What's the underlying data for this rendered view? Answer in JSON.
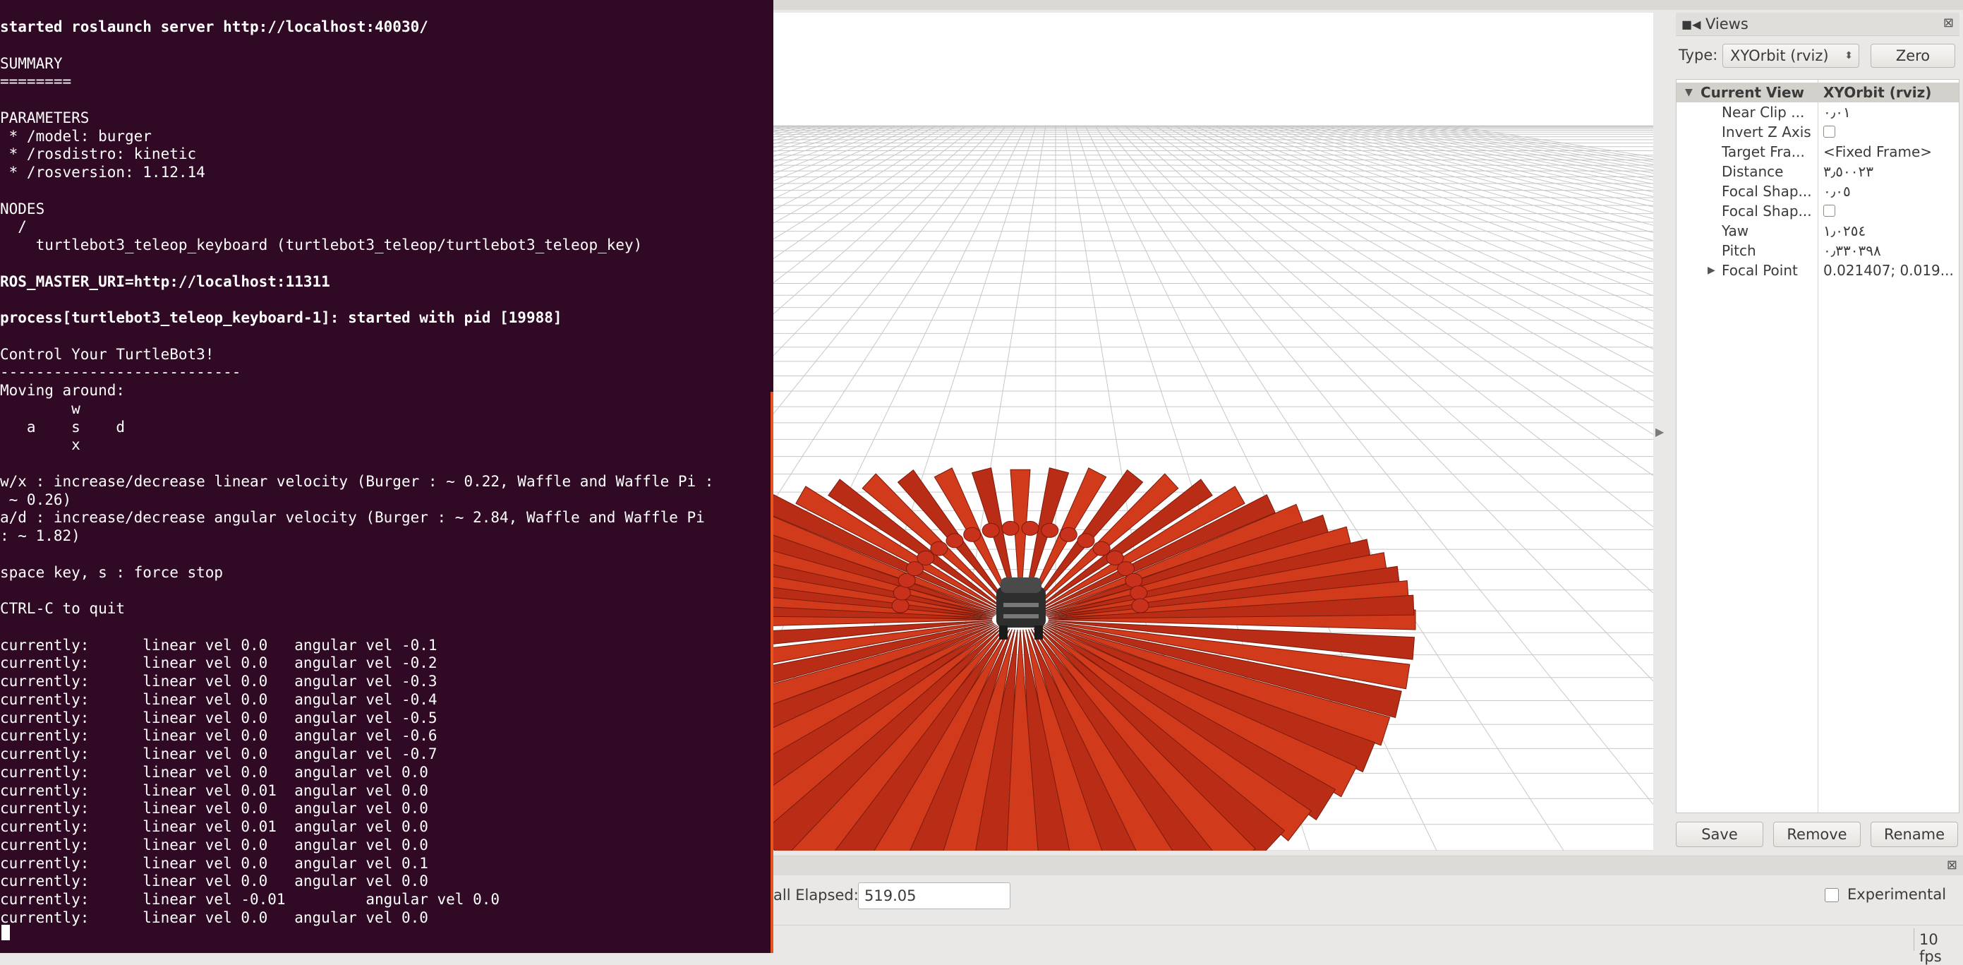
{
  "terminal": {
    "lines": [
      {
        "text": "started roslaunch server http://localhost:40030/",
        "bold": true
      },
      {
        "text": "",
        "bold": false
      },
      {
        "text": "SUMMARY",
        "bold": false
      },
      {
        "text": "========",
        "bold": false
      },
      {
        "text": "",
        "bold": false
      },
      {
        "text": "PARAMETERS",
        "bold": false
      },
      {
        "text": " * /model: burger",
        "bold": false
      },
      {
        "text": " * /rosdistro: kinetic",
        "bold": false
      },
      {
        "text": " * /rosversion: 1.12.14",
        "bold": false
      },
      {
        "text": "",
        "bold": false
      },
      {
        "text": "NODES",
        "bold": false
      },
      {
        "text": "  /",
        "bold": false
      },
      {
        "text": "    turtlebot3_teleop_keyboard (turtlebot3_teleop/turtlebot3_teleop_key)",
        "bold": false
      },
      {
        "text": "",
        "bold": false
      },
      {
        "text": "ROS_MASTER_URI=http://localhost:11311",
        "bold": true
      },
      {
        "text": "",
        "bold": false
      },
      {
        "text": "process[turtlebot3_teleop_keyboard-1]: started with pid [19988]",
        "bold": true
      },
      {
        "text": "",
        "bold": false
      },
      {
        "text": "Control Your TurtleBot3!",
        "bold": false
      },
      {
        "text": "---------------------------",
        "bold": false
      },
      {
        "text": "Moving around:",
        "bold": false
      },
      {
        "text": "        w",
        "bold": false
      },
      {
        "text": "   a    s    d",
        "bold": false
      },
      {
        "text": "        x",
        "bold": false
      },
      {
        "text": "",
        "bold": false
      },
      {
        "text": "w/x : increase/decrease linear velocity (Burger : ~ 0.22, Waffle and Waffle Pi :",
        "bold": false
      },
      {
        "text": " ~ 0.26)",
        "bold": false
      },
      {
        "text": "a/d : increase/decrease angular velocity (Burger : ~ 2.84, Waffle and Waffle Pi",
        "bold": false
      },
      {
        "text": ": ~ 1.82)",
        "bold": false
      },
      {
        "text": "",
        "bold": false
      },
      {
        "text": "space key, s : force stop",
        "bold": false
      },
      {
        "text": "",
        "bold": false
      },
      {
        "text": "CTRL-C to quit",
        "bold": false
      },
      {
        "text": "",
        "bold": false
      },
      {
        "text": "currently:\tlinear vel 0.0\t angular vel -0.1",
        "bold": false
      },
      {
        "text": "currently:\tlinear vel 0.0\t angular vel -0.2",
        "bold": false
      },
      {
        "text": "currently:\tlinear vel 0.0\t angular vel -0.3",
        "bold": false
      },
      {
        "text": "currently:\tlinear vel 0.0\t angular vel -0.4",
        "bold": false
      },
      {
        "text": "currently:\tlinear vel 0.0\t angular vel -0.5",
        "bold": false
      },
      {
        "text": "currently:\tlinear vel 0.0\t angular vel -0.6",
        "bold": false
      },
      {
        "text": "currently:\tlinear vel 0.0\t angular vel -0.7",
        "bold": false
      },
      {
        "text": "currently:\tlinear vel 0.0\t angular vel 0.0",
        "bold": false
      },
      {
        "text": "currently:\tlinear vel 0.01\t angular vel 0.0",
        "bold": false
      },
      {
        "text": "currently:\tlinear vel 0.0\t angular vel 0.0",
        "bold": false
      },
      {
        "text": "currently:\tlinear vel 0.01\t angular vel 0.0",
        "bold": false
      },
      {
        "text": "currently:\tlinear vel 0.0\t angular vel 0.0",
        "bold": false
      },
      {
        "text": "currently:\tlinear vel 0.0\t angular vel 0.1",
        "bold": false
      },
      {
        "text": "currently:\tlinear vel 0.0\t angular vel 0.0",
        "bold": false
      },
      {
        "text": "currently:\tlinear vel -0.01\t angular vel 0.0",
        "bold": false
      },
      {
        "text": "currently:\tlinear vel 0.0\t angular vel 0.0",
        "bold": false
      }
    ]
  },
  "views": {
    "title": "Views",
    "type_label": "Type:",
    "type_value": "XYOrbit (rviz)",
    "zero_label": "Zero",
    "header": {
      "name": "Current View",
      "value": "XYOrbit (rviz)"
    },
    "properties": [
      {
        "name": "Near Clip ...",
        "value": "٠٫٠١",
        "kind": "text"
      },
      {
        "name": "Invert Z Axis",
        "value": "",
        "kind": "check"
      },
      {
        "name": "Target Fra...",
        "value": "<Fixed Frame>",
        "kind": "text"
      },
      {
        "name": "Distance",
        "value": "٣٫٥٠٠٢٣",
        "kind": "text"
      },
      {
        "name": "Focal Shap...",
        "value": "٠٫٠٥",
        "kind": "text"
      },
      {
        "name": "Focal Shap...",
        "value": "",
        "kind": "check"
      },
      {
        "name": "Yaw",
        "value": "١٫٠٢٥٤",
        "kind": "text"
      },
      {
        "name": "Pitch",
        "value": "٠٫٣٣٠٣٩٨",
        "kind": "text"
      },
      {
        "name": "Focal Point",
        "value": "0.021407; 0.019...",
        "kind": "text",
        "expandable": true
      }
    ],
    "buttons": {
      "save": "Save",
      "remove": "Remove",
      "rename": "Rename"
    }
  },
  "time": {
    "wall_elapsed_label": "all Elapsed:",
    "wall_elapsed_value": "519.05",
    "experimental_label": "Experimental"
  },
  "status": {
    "fps": "10 fps"
  },
  "colors": {
    "terminal_bg": "#300a24",
    "arrow_red": "#c8321c",
    "ubuntu_orange": "#e95420"
  }
}
